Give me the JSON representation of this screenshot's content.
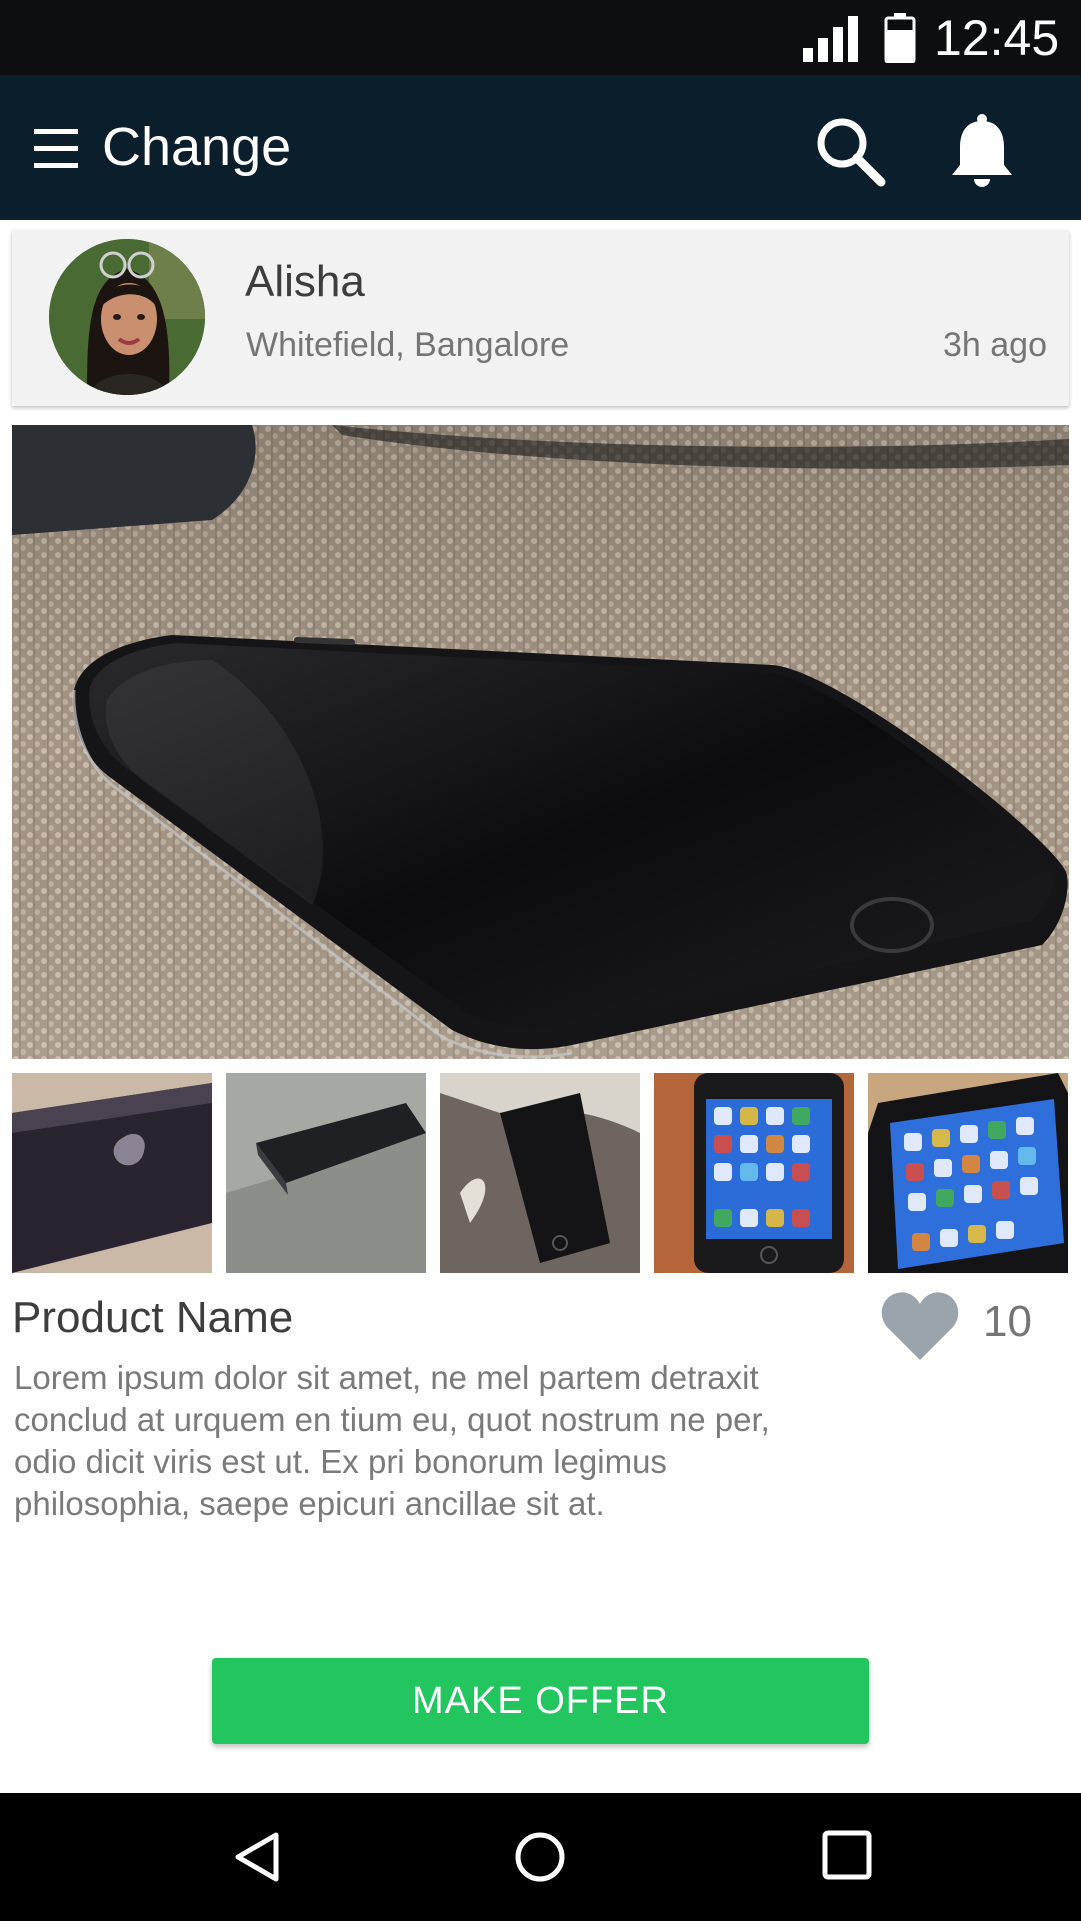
{
  "status_bar": {
    "time": "12:45",
    "icons": [
      "signal-icon",
      "battery-icon"
    ]
  },
  "app_bar": {
    "title": "Change",
    "icons": [
      "menu-icon",
      "search-icon",
      "bell-icon"
    ]
  },
  "post": {
    "user_name": "Alisha",
    "location": "Whitefield, Bangalore",
    "time_ago": "3h ago"
  },
  "product": {
    "name": "Product Name",
    "likes": "10",
    "description": "Lorem ipsum dolor sit amet, ne mel partem detraxit conclud at urquem en tium eu, quot nostrum ne per, odio dicit viris est ut. Ex pri bonorum legimus philosophia, saepe epicuri ancillae sit at.",
    "thumbnail_count": 5
  },
  "actions": {
    "offer_label": "MAKE OFFER"
  },
  "nav_bar": {
    "icons": [
      "back-icon",
      "home-icon",
      "recents-icon"
    ]
  },
  "colors": {
    "status_bar": "#0c0e10",
    "app_bar": "#0a1e2b",
    "card_bg": "#f2f2f2",
    "accent_green": "#22c55e",
    "like_grey": "#9aa4ac",
    "text_dark": "#3d3d3d",
    "text_muted": "#757575"
  }
}
